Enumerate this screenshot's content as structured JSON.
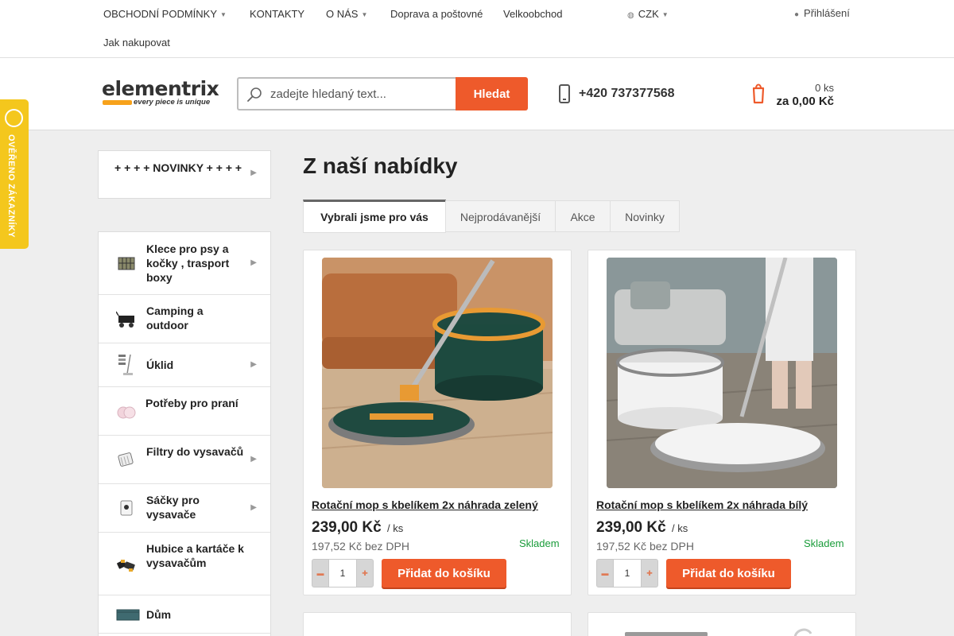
{
  "top_nav": {
    "items": [
      "OBCHODNÍ PODMÍNKY",
      "KONTAKTY",
      "O NÁS",
      "Doprava a poštovné",
      "Velkoobchod",
      "Jak nakupovat"
    ],
    "currency": "CZK",
    "login": "Přihlášení"
  },
  "header": {
    "logo_word": "elementrix",
    "logo_tagline": "every piece is unique",
    "search_placeholder": "zadejte hledaný text...",
    "search_button": "Hledat",
    "phone": "+420 737377568",
    "cart_qty": "0 ks",
    "cart_total": "za 0,00 Kč"
  },
  "badge": {
    "text": "OVĚŘENO ZÁKAZNÍKY"
  },
  "sidebar": {
    "novinky": "+ + + + NOVINKY + + + +",
    "categories": [
      "Klece pro psy a kočky , trasport boxy",
      "Camping a outdoor",
      "Úklid",
      "Potřeby pro praní",
      "Filtry do vysavačů",
      "Sáčky pro vysavače",
      "Hubice a kartáče k vysavačům",
      "Dům"
    ]
  },
  "main": {
    "heading": "Z naší nabídky",
    "tabs": [
      "Vybrali jsme pro vás",
      "Nejprodávanější",
      "Akce",
      "Novinky"
    ],
    "products": [
      {
        "title": "Rotační mop s kbelíkem 2x náhrada zelený",
        "price": "239,00 Kč",
        "unit": "/ ks",
        "price_net": "197,52 Kč bez DPH",
        "stock": "Skladem",
        "qty": "1",
        "add_label": "Přidat do košíku"
      },
      {
        "title": "Rotační mop s kbelíkem 2x náhrada bílý",
        "price": "239,00 Kč",
        "unit": "/ ks",
        "price_net": "197,52 Kč bez DPH",
        "stock": "Skladem",
        "qty": "1",
        "add_label": "Přidat do košíku"
      }
    ]
  },
  "colors": {
    "accent": "#ee5a2b",
    "stock": "#1a9c3a",
    "badge": "#f4c71d"
  },
  "icons": [
    "chevron-down-icon",
    "globe-icon",
    "user-icon",
    "search-icon",
    "phone-icon",
    "cart-icon",
    "chevron-right-icon",
    "minus-icon",
    "plus-icon"
  ]
}
